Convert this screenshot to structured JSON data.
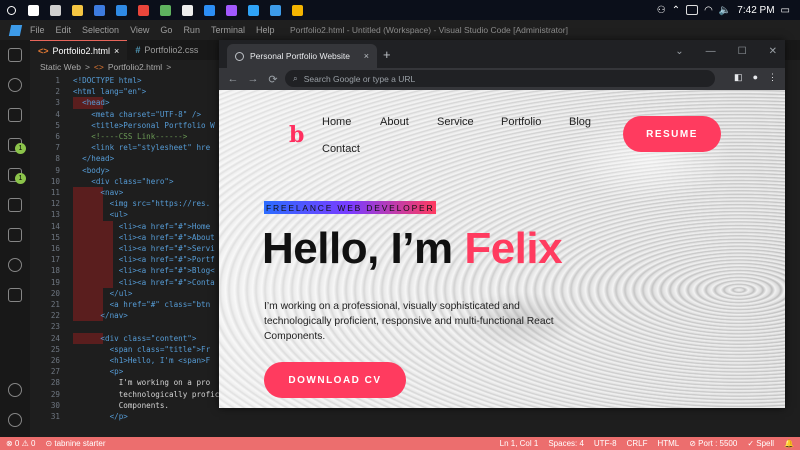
{
  "taskbar": {
    "time": "7:42 PM",
    "icons": [
      {
        "name": "search-icon",
        "color": "#ffffff"
      },
      {
        "name": "windows-start-icon",
        "color": "#ffffff"
      },
      {
        "name": "task-view-icon",
        "color": "#cfcfcf"
      },
      {
        "name": "file-explorer-icon",
        "color": "#f4c542"
      },
      {
        "name": "store-icon",
        "color": "#3d7be0"
      },
      {
        "name": "mail-icon",
        "color": "#2f8ae6"
      },
      {
        "name": "chrome-icon",
        "color": "#e9453b"
      },
      {
        "name": "app-icon",
        "color": "#5fb35f"
      },
      {
        "name": "discord-icon",
        "color": "#eeeeee"
      },
      {
        "name": "photos-icon",
        "color": "#2c8ef5"
      },
      {
        "name": "figma-icon",
        "color": "#a259ff"
      },
      {
        "name": "photoshop-icon",
        "color": "#2fa3f7"
      },
      {
        "name": "vscode-icon",
        "color": "#3d9be9"
      },
      {
        "name": "chrome-icon-2",
        "color": "#f4b400"
      }
    ]
  },
  "vscode": {
    "menu": [
      "File",
      "Edit",
      "Selection",
      "View",
      "Go",
      "Run",
      "Terminal",
      "Help"
    ],
    "window_title": "Portfolio2.html - Untitled (Workspace) - Visual Studio Code [Administrator]",
    "tabs": [
      {
        "glyph": "<>",
        "label": "Portfolio2.html",
        "close": "×"
      },
      {
        "glyph": "#",
        "label": "Portfolio2.css",
        "close": ""
      }
    ],
    "breadcrumb": [
      "Static Web",
      ">",
      "<>",
      "Portfolio2.html",
      ">"
    ],
    "activity_badges": [
      "1",
      "1"
    ],
    "lines": [
      {
        "n": "1",
        "text": "<!DOCTYPE html>",
        "hl": 0
      },
      {
        "n": "2",
        "text": "<html lang=\"en\">",
        "hl": 0
      },
      {
        "n": "3",
        "text": "  <head>",
        "hl": 1
      },
      {
        "n": "4",
        "text": "    <meta charset=\"UTF-8\" />",
        "hl": 0
      },
      {
        "n": "5",
        "text": "    <title>Personal Portfolio W",
        "hl": 0
      },
      {
        "n": "6",
        "text": "    <!----CSS Link------>",
        "hl": 0
      },
      {
        "n": "7",
        "text": "    <link rel=\"stylesheet\" hre",
        "hl": 0
      },
      {
        "n": "8",
        "text": "  </head>",
        "hl": 0
      },
      {
        "n": "9",
        "text": "  <body>",
        "hl": 0
      },
      {
        "n": "10",
        "text": "    <div class=\"hero\">",
        "hl": 0
      },
      {
        "n": "11",
        "text": "      <nav>",
        "hl": 1
      },
      {
        "n": "12",
        "text": "        <img src=\"https://res.",
        "hl": 1
      },
      {
        "n": "13",
        "text": "        <ul>",
        "hl": 1
      },
      {
        "n": "14",
        "text": "          <li><a href=\"#\">Home",
        "hl": 2
      },
      {
        "n": "15",
        "text": "          <li><a href=\"#\">About",
        "hl": 2
      },
      {
        "n": "16",
        "text": "          <li><a href=\"#\">Servi",
        "hl": 2
      },
      {
        "n": "17",
        "text": "          <li><a href=\"#\">Portf",
        "hl": 2
      },
      {
        "n": "18",
        "text": "          <li><a href=\"#\">Blog<",
        "hl": 2
      },
      {
        "n": "19",
        "text": "          <li><a href=\"#\">Conta",
        "hl": 2
      },
      {
        "n": "20",
        "text": "        </ul>",
        "hl": 1
      },
      {
        "n": "21",
        "text": "        <a href=\"#\" class=\"btn",
        "hl": 1
      },
      {
        "n": "22",
        "text": "      </nav>",
        "hl": 1
      },
      {
        "n": "23",
        "text": "",
        "hl": 0
      },
      {
        "n": "24",
        "text": "      <div class=\"content\">",
        "hl": 1
      },
      {
        "n": "25",
        "text": "        <span class=\"title\">Fr",
        "hl": 0
      },
      {
        "n": "26",
        "text": "        <h1>Hello, I'm <span>F",
        "hl": 0
      },
      {
        "n": "27",
        "text": "        <p>",
        "hl": 0
      },
      {
        "n": "28",
        "text": "          I'm working on a pro",
        "hl": 0
      },
      {
        "n": "29",
        "text": "          technologically proficient, responsive and multi-functional React",
        "hl": 0
      },
      {
        "n": "30",
        "text": "          Components.",
        "hl": 0
      },
      {
        "n": "31",
        "text": "        </p>",
        "hl": 0
      }
    ],
    "status": {
      "left": [
        "⊗ 0 ⚠ 0",
        "⊙ tabnine starter"
      ],
      "right": [
        "Ln 1, Col 1",
        "Spaces: 4",
        "UTF-8",
        "CRLF",
        "HTML",
        "⊘ Port : 5500",
        "✓ Spell",
        "🔔"
      ]
    }
  },
  "chrome": {
    "tab_title": "Personal Portfolio Website",
    "tab_close": "×",
    "new_tab": "+",
    "omnibox_placeholder": "Search Google or type a URL",
    "window_controls": [
      "⌄",
      "—",
      "☐",
      "✕"
    ],
    "nav": [
      "←",
      "→",
      "⟳"
    ]
  },
  "site": {
    "logo": "b",
    "nav": [
      "Home",
      "About",
      "Service",
      "Portfolio",
      "Blog",
      "Contact"
    ],
    "resume_label": "RESUME",
    "subtitle": "FREELANCE WEB DEVELOPER",
    "title_prefix": "Hello, I’m ",
    "title_name": "Felix",
    "description": "I’m working on a professional, visually sophisticated and technologically proficient, responsive and multi-functional React Components.",
    "download_label": "DOWNLOAD CV",
    "accent": "#ff3b5f"
  }
}
